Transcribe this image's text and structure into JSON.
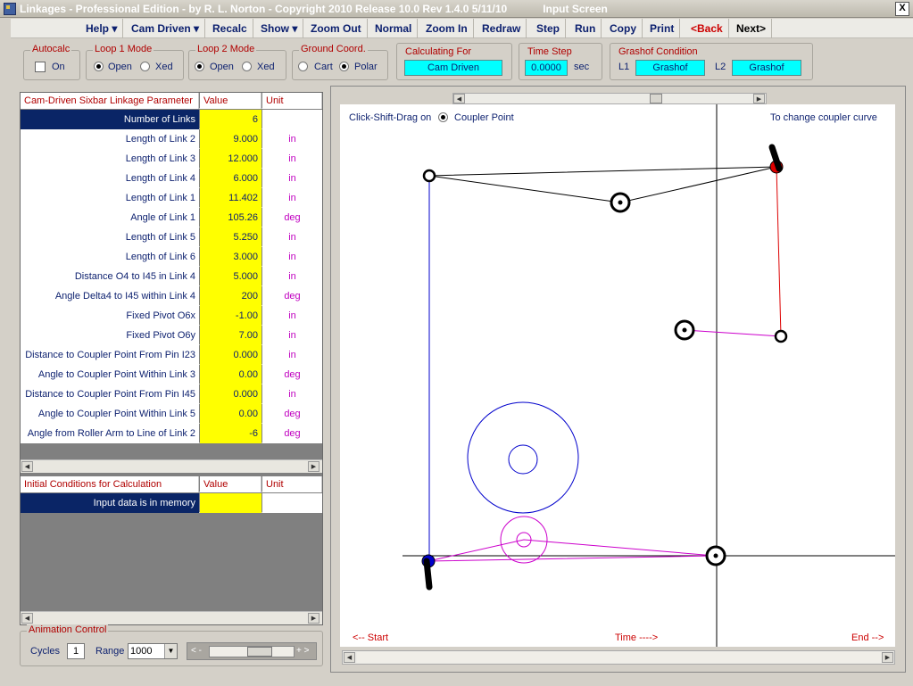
{
  "window": {
    "title": "Linkages - Professional Edition - by R. L. Norton - Copyright 2010   Release 10.0   Rev 1.4.0   5/11/10",
    "subtitle": "Input Screen",
    "close_label": "X"
  },
  "menu": {
    "help": "Help ▾",
    "cam_driven": "Cam Driven ▾",
    "recalc": "Recalc",
    "show": "Show ▾",
    "zoom_out": "Zoom Out",
    "normal": "Normal",
    "zoom_in": "Zoom In",
    "redraw": "Redraw",
    "step": "Step",
    "run": "Run",
    "copy": "Copy",
    "print": "Print",
    "back": "<Back",
    "next": "Next>"
  },
  "toolstrip": {
    "autocalc": {
      "label": "Autocalc",
      "option": "On"
    },
    "loop1": {
      "label": "Loop 1 Mode",
      "opt1": "Open",
      "opt2": "Xed"
    },
    "loop2": {
      "label": "Loop 2 Mode",
      "opt1": "Open",
      "opt2": "Xed"
    },
    "ground": {
      "label": "Ground Coord.",
      "opt1": "Cart",
      "opt2": "Polar"
    },
    "calculating": {
      "label": "Calculating For",
      "value": "Cam Driven"
    },
    "timestep": {
      "label": "Time Step",
      "value": "0.0000",
      "unit": "sec"
    },
    "grashof": {
      "label": "Grashof Condition",
      "l1": "L1",
      "l1_value": "Grashof",
      "l2": "L2",
      "l2_value": "Grashof"
    }
  },
  "params": {
    "header": {
      "param": "Cam-Driven Sixbar Linkage Parameter",
      "value": "Value",
      "unit": "Unit"
    },
    "rows": [
      {
        "p": "Number of Links",
        "v": "6",
        "u": ""
      },
      {
        "p": "Length of Link 2",
        "v": "9.000",
        "u": "in"
      },
      {
        "p": "Length of Link 3",
        "v": "12.000",
        "u": "in"
      },
      {
        "p": "Length of Link 4",
        "v": "6.000",
        "u": "in"
      },
      {
        "p": "Length of Link 1",
        "v": "11.402",
        "u": "in"
      },
      {
        "p": "Angle of Link 1",
        "v": "105.26",
        "u": "deg"
      },
      {
        "p": "Length of Link 5",
        "v": "5.250",
        "u": "in"
      },
      {
        "p": "Length of Link 6",
        "v": "3.000",
        "u": "in"
      },
      {
        "p": "Distance O4 to I45 in Link 4",
        "v": "5.000",
        "u": "in"
      },
      {
        "p": "Angle Delta4 to I45 within Link 4",
        "v": "200",
        "u": "deg"
      },
      {
        "p": "Fixed Pivot O6x",
        "v": "-1.00",
        "u": "in"
      },
      {
        "p": "Fixed Pivot O6y",
        "v": "7.00",
        "u": "in"
      },
      {
        "p": "Distance to Coupler Point From Pin I23",
        "v": "0.000",
        "u": "in"
      },
      {
        "p": "Angle to Coupler Point Within Link 3",
        "v": "0.00",
        "u": "deg"
      },
      {
        "p": "Distance to Coupler Point From Pin I45",
        "v": "0.000",
        "u": "in"
      },
      {
        "p": "Angle to Coupler Point Within Link 5",
        "v": "0.00",
        "u": "deg"
      },
      {
        "p": "Angle from Roller Arm to Line of Link 2",
        "v": "-6",
        "u": "deg"
      }
    ]
  },
  "initial": {
    "header": {
      "param": "Initial Conditions for Calculation",
      "value": "Value",
      "unit": "Unit"
    },
    "row": {
      "p": "Input data is in memory",
      "v": "",
      "u": ""
    }
  },
  "animation": {
    "label": "Animation Control",
    "cycles_label": "Cycles",
    "cycles_value": "1",
    "range_label": "Range",
    "range_value": "1000",
    "slider_left": "< -",
    "slider_right": "+ >"
  },
  "canvas": {
    "drag_prefix": "Click-Shift-Drag on",
    "drag_option": "Coupler Point",
    "drag_suffix": "To change coupler curve",
    "start": "<-- Start",
    "time": "Time ---->",
    "end": "End -->"
  },
  "colors": {
    "menu_text": "#0b1f6e",
    "label_red": "#b00000",
    "link_magenta": "#cc00cc",
    "link_red": "#dd0000",
    "cam_blue": "#0000cc",
    "yellow": "#ffff00",
    "cyan": "#00ffff"
  }
}
